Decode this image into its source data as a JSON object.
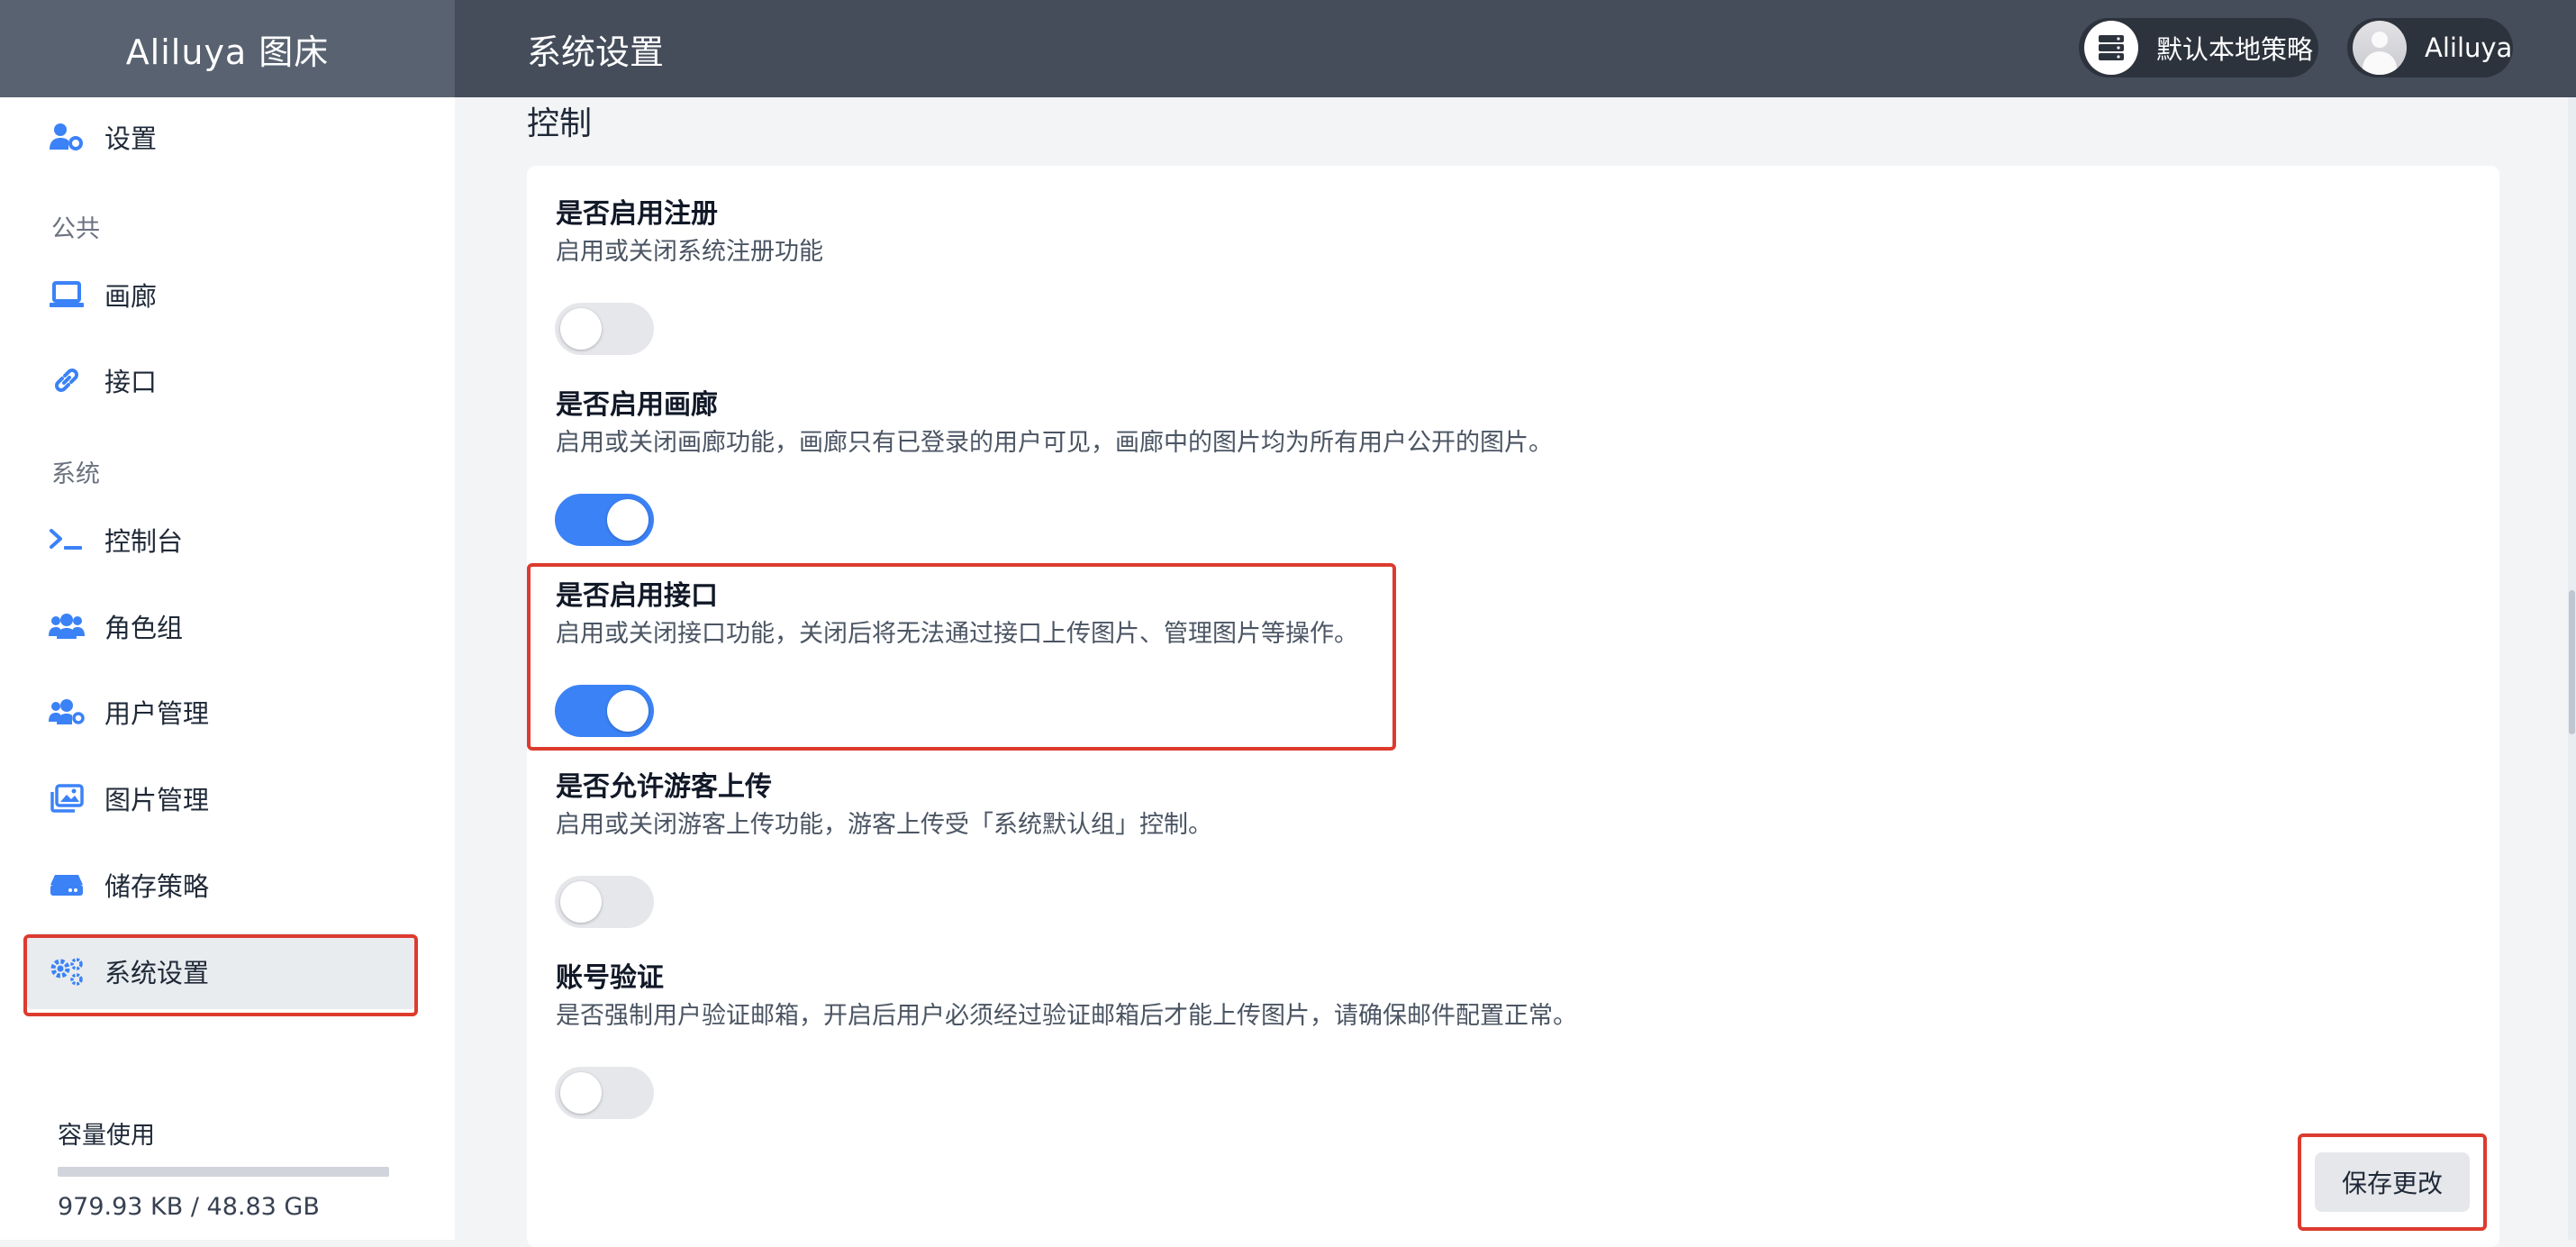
{
  "header": {
    "brand": "Aliluya 图床",
    "page_title": "系统设置",
    "strategy_label": "默认本地策略",
    "user_name": "Aliluya"
  },
  "sidebar": {
    "top_item": {
      "label": "设置",
      "icon": "user-gear-icon"
    },
    "groups": [
      {
        "label": "公共",
        "items": [
          {
            "label": "画廊",
            "icon": "laptop-icon"
          },
          {
            "label": "接口",
            "icon": "link-icon"
          }
        ]
      },
      {
        "label": "系统",
        "items": [
          {
            "label": "控制台",
            "icon": "terminal-icon"
          },
          {
            "label": "角色组",
            "icon": "users-icon"
          },
          {
            "label": "用户管理",
            "icon": "users-gear-icon"
          },
          {
            "label": "图片管理",
            "icon": "images-icon"
          },
          {
            "label": "储存策略",
            "icon": "hard-drive-icon"
          },
          {
            "label": "系统设置",
            "icon": "gears-icon",
            "active": true
          }
        ]
      }
    ],
    "storage": {
      "title": "容量使用",
      "usage_text": "979.93 KB / 48.83 GB",
      "usage_fraction": 2e-05
    }
  },
  "main": {
    "section_title": "控制",
    "settings": [
      {
        "title": "是否启用注册",
        "description": "启用或关闭系统注册功能",
        "enabled": false
      },
      {
        "title": "是否启用画廊",
        "description": "启用或关闭画廊功能，画廊只有已登录的用户可见，画廊中的图片均为所有用户公开的图片。",
        "enabled": true
      },
      {
        "title": "是否启用接口",
        "description": "启用或关闭接口功能，关闭后将无法通过接口上传图片、管理图片等操作。",
        "enabled": true
      },
      {
        "title": "是否允许游客上传",
        "description": "启用或关闭游客上传功能，游客上传受「系统默认组」控制。",
        "enabled": false
      },
      {
        "title": "账号验证",
        "description": "是否强制用户验证邮箱，开启后用户必须经过验证邮箱后才能上传图片，请确保邮件配置正常。",
        "enabled": false
      }
    ],
    "save_label": "保存更改"
  },
  "colors": {
    "accent": "#3b82f6",
    "highlight": "#dc3b2f",
    "header": "#454d5b"
  }
}
